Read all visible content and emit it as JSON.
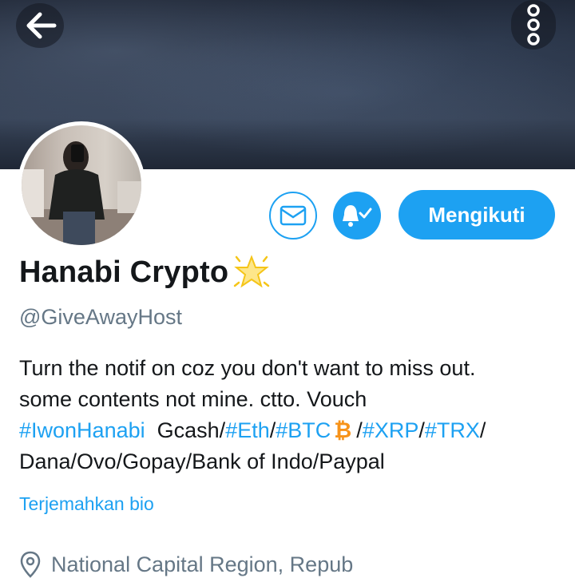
{
  "profile": {
    "display_name": "Hanabi Crypto",
    "handle": "@GiveAwayHost",
    "follow_label": "Mengikuti",
    "translate_label": "Terjemahkan bio",
    "location": "National Capital Region, Repub"
  },
  "bio": {
    "line1": "Turn the notif on coz you don't want to miss out.",
    "line2": "some contents not mine. ctto. Vouch",
    "tag_hanabi": "#IwonHanabi",
    "gcash": "Gcash/",
    "tag_eth": "#Eth",
    "slash1": "/",
    "tag_btc": "#BTC",
    "btc_symbol": "₿",
    "slash2": "/",
    "tag_xrp": "#XRP",
    "slash3": "/",
    "tag_trx": "#TRX",
    "slash4": "/",
    "line4": "Dana/Ovo/Gopay/Bank of Indo/Paypal"
  },
  "icons": {
    "back": "back-arrow-icon",
    "more": "more-vertical-icon",
    "message": "mail-icon",
    "notifications": "bell-check-icon",
    "badge": "glowing-star-icon",
    "location": "location-pin-icon"
  },
  "colors": {
    "accent": "#1da1f2",
    "secondary_text": "#657786",
    "text": "#14171a",
    "bitcoin": "#f7931a"
  }
}
